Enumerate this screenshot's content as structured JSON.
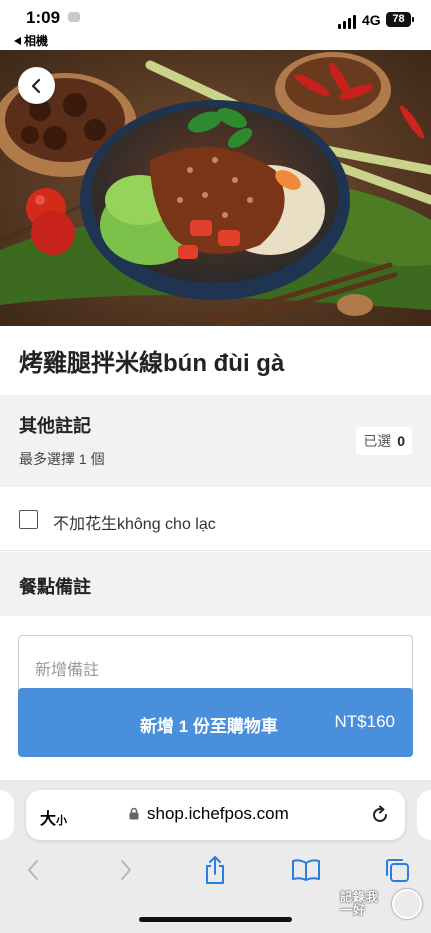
{
  "status_bar": {
    "time": "1:09",
    "back_app": "相機",
    "network": "4G",
    "battery": "78"
  },
  "hero": {
    "image_alt": "grilled chicken thigh rice noodle bowl photo",
    "back_icon": "chevron-left-icon"
  },
  "product": {
    "title": "烤雞腿拌米線bún đùi gà"
  },
  "options": {
    "title": "其他註記",
    "subtitle": "最多選擇 1 個",
    "selected_label": "已選",
    "selected_count": "0",
    "items": [
      {
        "label": "不加花生không cho lạc",
        "checked": false
      }
    ]
  },
  "notes": {
    "title": "餐點備註",
    "placeholder": "新增備註"
  },
  "cart_button": {
    "label": "新增 1 份至購物車",
    "price": "NT$160",
    "color": "#4a8fdc"
  },
  "safari": {
    "text_size": "大",
    "text_size_small": "小",
    "url": "shop.ichefpos.com",
    "icons": [
      "back-icon",
      "forward-icon",
      "share-icon",
      "bookmarks-icon",
      "tabs-icon"
    ]
  },
  "watermark": {
    "line1": "記錄我",
    "line2": "一好"
  }
}
